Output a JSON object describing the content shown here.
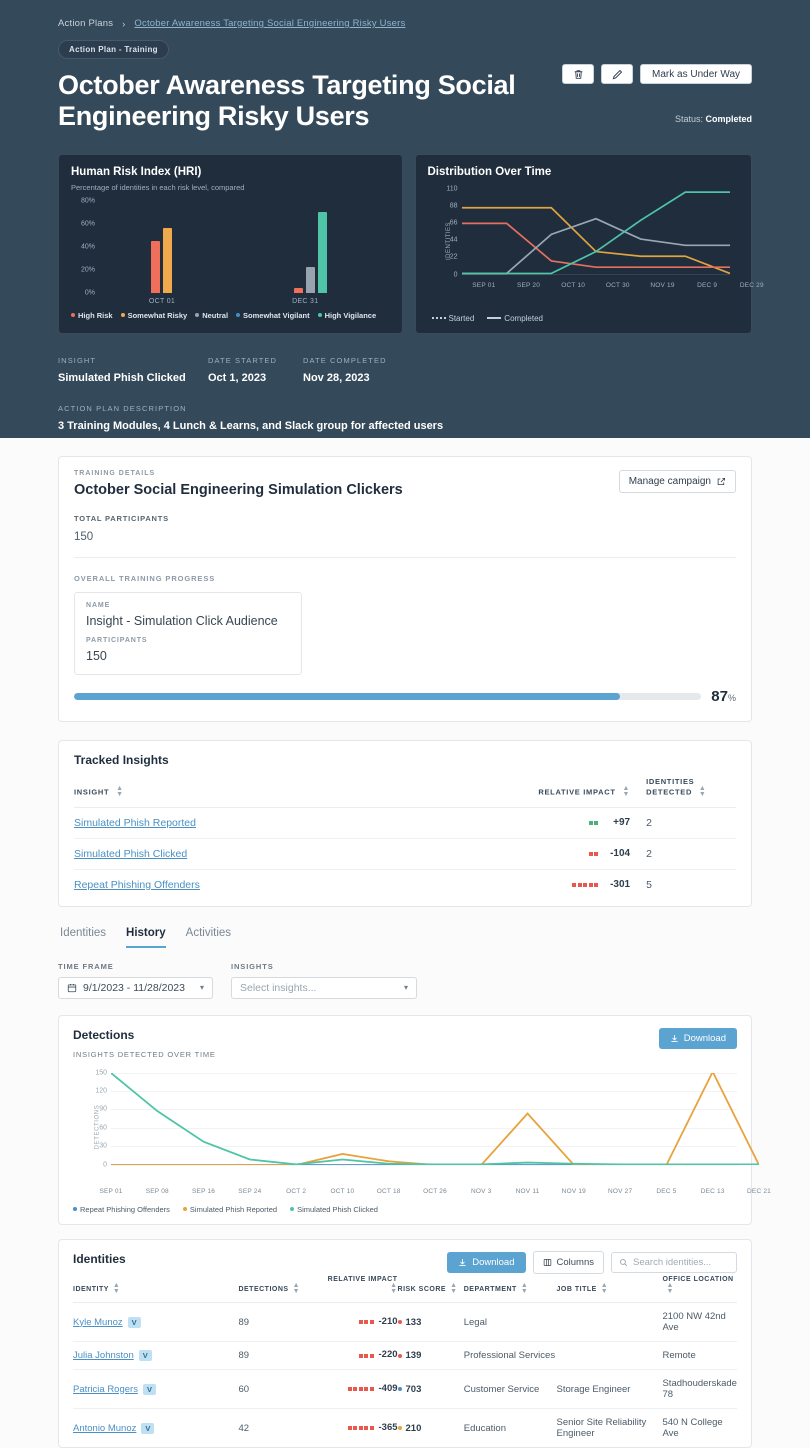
{
  "breadcrumb": {
    "root": "Action Plans",
    "chevron": "›",
    "current": "October Awareness Targeting Social Engineering Risky Users"
  },
  "hero": {
    "pill": "Action Plan - Training",
    "title": "October Awareness Targeting Social Engineering Risky Users",
    "delete_icon": "trash-icon",
    "edit_icon": "pencil-icon",
    "primary_action": "Mark as Under Way",
    "status_label": "Status:",
    "status_value": "Completed"
  },
  "meta": {
    "insight_label": "INSIGHT",
    "insight_value": "Simulated Phish Clicked",
    "date_started_label": "DATE STARTED",
    "date_started_value": "Oct 1, 2023",
    "date_completed_label": "DATE COMPLETED",
    "date_completed_value": "Nov 28, 2023",
    "description_label": "ACTION PLAN DESCRIPTION",
    "description_value": "3 Training Modules, 4 Lunch & Learns, and Slack group for affected users"
  },
  "chart_data": [
    {
      "type": "bar",
      "title": "Human Risk Index (HRI)",
      "subtitle": "Percentage of identities in each risk level, compared",
      "categories": [
        "OCT 01",
        "DEC 31"
      ],
      "ylabel": "",
      "ytick_labels": [
        "80%",
        "60%",
        "40%",
        "20%",
        "0%"
      ],
      "ylim": [
        0,
        80
      ],
      "grid": false,
      "legend_position": "bottom",
      "series": [
        {
          "name": "High Risk",
          "color": "#ef6f5a",
          "values": [
            45,
            4
          ]
        },
        {
          "name": "Somewhat Risky",
          "color": "#f0a94c",
          "values": [
            56,
            0
          ]
        },
        {
          "name": "Neutral",
          "color": "#97a3ae",
          "values": [
            0,
            22
          ]
        },
        {
          "name": "Somewhat Vigilant",
          "color": "#3f8fc4",
          "values": [
            0,
            0
          ]
        },
        {
          "name": "High Vigilance",
          "color": "#4fc4a6",
          "values": [
            0,
            70
          ]
        }
      ]
    },
    {
      "type": "line",
      "title": "Distribution Over Time",
      "ylabel": "IDENTITIES",
      "ytick_labels": [
        "110",
        "88",
        "66",
        "44",
        "22",
        "0"
      ],
      "ylim": [
        0,
        110
      ],
      "x": [
        "SEP 01",
        "SEP 20",
        "OCT 10",
        "OCT 30",
        "NOV 19",
        "DEC 9",
        "DEC 29"
      ],
      "grid": false,
      "legend_position": "bottom",
      "legend_entries": [
        {
          "label": "Started",
          "style": "dotted"
        },
        {
          "label": "Completed",
          "style": "solid"
        }
      ],
      "series": [
        {
          "name": "Somewhat Risky",
          "color": "#e2a340",
          "values": [
            86,
            86,
            86,
            30,
            24,
            24,
            2
          ]
        },
        {
          "name": "High Risk",
          "color": "#e5705f",
          "values": [
            66,
            66,
            18,
            10,
            10,
            10,
            10
          ]
        },
        {
          "name": "Neutral",
          "color": "#9aa7b3",
          "values": [
            2,
            2,
            52,
            72,
            46,
            38,
            38
          ]
        },
        {
          "name": "High Vigilance",
          "color": "#4fc4a6",
          "values": [
            2,
            2,
            2,
            30,
            70,
            106,
            106
          ]
        }
      ]
    },
    {
      "type": "line",
      "title": "Detections",
      "subtitle": "INSIGHTS DETECTED OVER TIME",
      "ylabel": "DETECTIONS",
      "ytick_labels": [
        "150",
        "120",
        "90",
        "60",
        "30",
        "0"
      ],
      "ylim": [
        0,
        150
      ],
      "grid": true,
      "legend_position": "bottom",
      "x": [
        "SEP 01",
        "SEP 08",
        "SEP 16",
        "SEP 24",
        "OCT 2",
        "OCT 10",
        "OCT 18",
        "OCT 26",
        "NOV 3",
        "NOV 11",
        "NOV 19",
        "NOV 27",
        "DEC 5",
        "DEC 13",
        "DEC 21"
      ],
      "series": [
        {
          "name": "Repeat Phishing Offenders",
          "color": "#4a90c4",
          "values": [
            0,
            0,
            0,
            0,
            0,
            0,
            0,
            0,
            0,
            0,
            0,
            0,
            0,
            0,
            0
          ]
        },
        {
          "name": "Simulated Phish Reported",
          "color": "#e8a33d",
          "values": [
            0,
            0,
            0,
            0,
            0,
            18,
            6,
            0,
            0,
            84,
            0,
            0,
            0,
            152,
            0
          ]
        },
        {
          "name": "Simulated Phish Clicked",
          "color": "#4fc4a6",
          "values": [
            150,
            88,
            38,
            9,
            1,
            9,
            2,
            1,
            1,
            4,
            2,
            1,
            1,
            1,
            1
          ]
        }
      ]
    }
  ],
  "training": {
    "eyebrow": "TRAINING DETAILS",
    "title": "October Social Engineering Simulation Clickers",
    "manage_label": "Manage campaign",
    "manage_icon": "external-link-icon",
    "total_participants_label": "TOTAL PARTICIPANTS",
    "total_participants_value": "150",
    "progress_label": "OVERALL TRAINING PROGRESS",
    "name_label": "NAME",
    "name_value": "Insight - Simulation Click Audience",
    "participants_label": "PARTICIPANTS",
    "participants_value": "150",
    "progress_percent": 87,
    "progress_percent_text": "87",
    "percent_symbol": "%"
  },
  "tracked_insights": {
    "title": "Tracked Insights",
    "columns": [
      "INSIGHT",
      "RELATIVE IMPACT",
      "IDENTITIES DETECTED"
    ],
    "rows": [
      {
        "insight": "Simulated Phish Reported",
        "impact": "+97",
        "dots": 2,
        "dot_color": "#4caf7d",
        "detected": "2"
      },
      {
        "insight": "Simulated Phish Clicked",
        "impact": "-104",
        "dots": 2,
        "dot_color": "#e8584c",
        "detected": "2"
      },
      {
        "insight": "Repeat Phishing Offenders",
        "impact": "-301",
        "dots": 5,
        "dot_color": "#e8584c",
        "detected": "5"
      }
    ]
  },
  "tabs": [
    {
      "label": "Identities",
      "active": false
    },
    {
      "label": "History",
      "active": true
    },
    {
      "label": "Activities",
      "active": false
    }
  ],
  "filters": {
    "time_frame_label": "TIME FRAME",
    "time_frame_value": "9/1/2023 - 11/28/2023",
    "calendar_icon": "calendar-icon",
    "insights_label": "INSIGHTS",
    "insights_placeholder": "Select insights...",
    "caret": "⌄"
  },
  "detections": {
    "download_label": "Download",
    "download_icon": "download-icon"
  },
  "identities": {
    "title": "Identities",
    "download_label": "Download",
    "download_icon": "download-icon",
    "columns_label": "Columns",
    "columns_icon": "columns-icon",
    "search_placeholder": "Search identities...",
    "search_icon": "search-icon",
    "headers": [
      "IDENTITY",
      "DETECTIONS",
      "RELATIVE IMPACT",
      "RISK SCORE",
      "DEPARTMENT",
      "JOB TITLE",
      "OFFICE LOCATION"
    ],
    "rows": [
      {
        "name": "Kyle Munoz",
        "badge": "V",
        "detections": "89",
        "impact": "-210",
        "dots": 3,
        "dot_color": "#e8584c",
        "risk": "133",
        "risk_color": "#e8584c",
        "department": "Legal",
        "job_title": "",
        "office": "2100 NW 42nd Ave"
      },
      {
        "name": "Julia Johnston",
        "badge": "V",
        "detections": "89",
        "impact": "-220",
        "dots": 3,
        "dot_color": "#e8584c",
        "risk": "139",
        "risk_color": "#e8584c",
        "department": "Professional Services",
        "job_title": "",
        "office": "Remote"
      },
      {
        "name": "Patricia Rogers",
        "badge": "V",
        "detections": "60",
        "impact": "-409",
        "dots": 5,
        "dot_color": "#e8584c",
        "risk": "703",
        "risk_color": "#4a90c4",
        "department": "Customer Service",
        "job_title": "Storage Engineer",
        "office": "Stadhouderskade 78"
      },
      {
        "name": "Antonio Munoz",
        "badge": "V",
        "detections": "42",
        "impact": "-365",
        "dots": 5,
        "dot_color": "#e8584c",
        "risk": "210",
        "risk_color": "#e8a33d",
        "department": "Education",
        "job_title": "Senior Site Reliability Engineer",
        "office": "540 N College Ave"
      }
    ]
  }
}
